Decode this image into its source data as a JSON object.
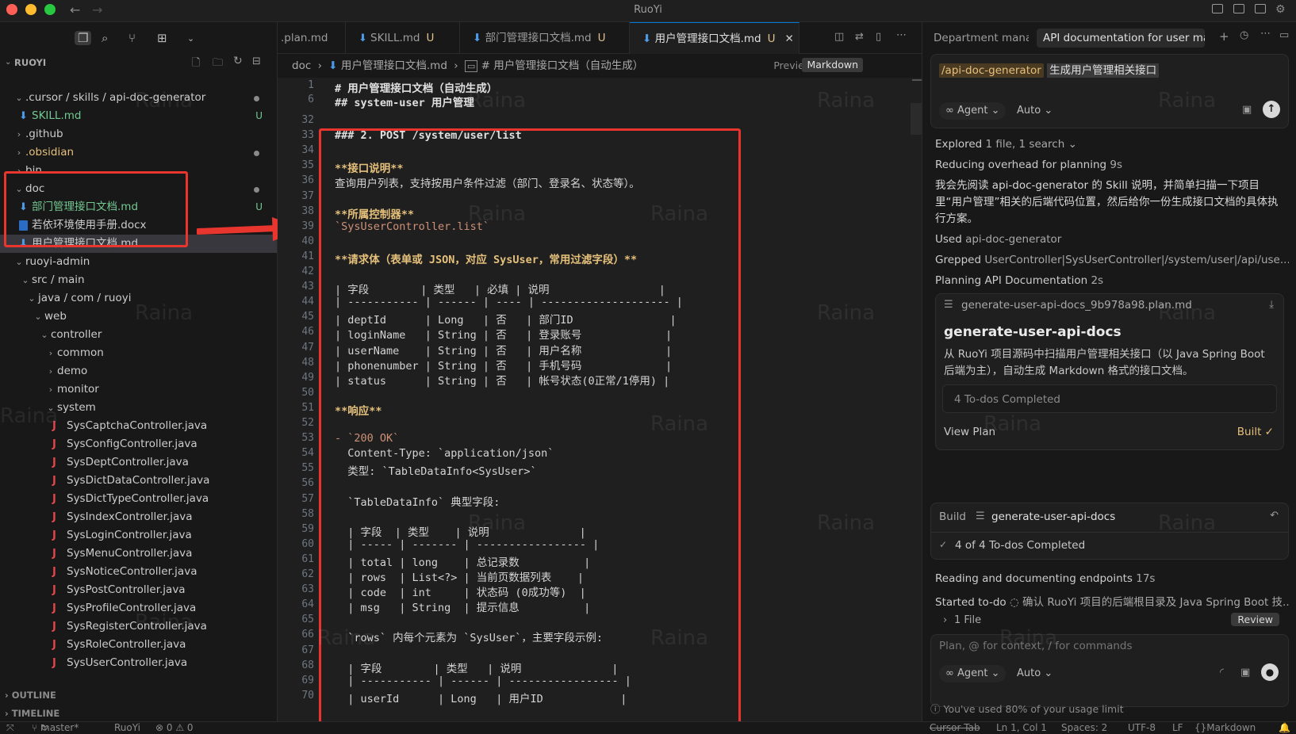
{
  "window": {
    "title": "RuoYi"
  },
  "sidebar": {
    "root_label": "RUOYI",
    "tree": [
      {
        "label": ".cursor / skills / api-doc-generator",
        "dot": true
      },
      {
        "label": "SKILL.md",
        "badge": "U"
      },
      {
        "label": ".github"
      },
      {
        "label": ".obsidian",
        "dot": true
      },
      {
        "label": "bin"
      },
      {
        "label": "doc",
        "dot": true
      },
      {
        "label": "部门管理接口文档.md",
        "badge": "U"
      },
      {
        "label": "若依环境使用手册.docx"
      },
      {
        "label": "用户管理接口文档.md"
      },
      {
        "label": "ruoyi-admin"
      },
      {
        "label": "src / main"
      },
      {
        "label": "java / com / ruoyi"
      },
      {
        "label": "web"
      },
      {
        "label": "controller"
      },
      {
        "label": "common"
      },
      {
        "label": "demo"
      },
      {
        "label": "monitor"
      },
      {
        "label": "system"
      },
      {
        "label": "SysCaptchaController.java"
      },
      {
        "label": "SysConfigController.java"
      },
      {
        "label": "SysDeptController.java"
      },
      {
        "label": "SysDictDataController.java"
      },
      {
        "label": "SysDictTypeController.java"
      },
      {
        "label": "SysIndexController.java"
      },
      {
        "label": "SysLoginController.java"
      },
      {
        "label": "SysMenuController.java"
      },
      {
        "label": "SysNoticeController.java"
      },
      {
        "label": "SysPostController.java"
      },
      {
        "label": "SysProfileController.java"
      },
      {
        "label": "SysRegisterController.java"
      },
      {
        "label": "SysRoleController.java"
      },
      {
        "label": "SysUserController.java"
      }
    ],
    "outline_label": "OUTLINE",
    "timeline_label": "TIMELINE"
  },
  "tabs": [
    {
      "label": ".plan.md"
    },
    {
      "label": "SKILL.md",
      "status": "U"
    },
    {
      "label": "部门管理接口文档.md",
      "status": "U"
    },
    {
      "label": "用户管理接口文档.md",
      "status": "U",
      "close": "✕"
    }
  ],
  "breadcrumb": {
    "parts": [
      "doc",
      "用户管理接口文档.md",
      "# 用户管理接口文档（自动生成）"
    ],
    "sep": "›",
    "preview": "Preview",
    "markdown": "Markdown"
  },
  "editor": {
    "lines": [
      {
        "n": "1",
        "text": "# 用户管理接口文档（自动生成）",
        "kind": "head"
      },
      {
        "n": "6",
        "text": "## system-user 用户管理",
        "kind": "head"
      },
      {
        "n": "32",
        "text": "",
        "kind": "plain"
      },
      {
        "n": "33",
        "text": "### 2. POST /system/user/list",
        "kind": "head"
      },
      {
        "n": "34",
        "text": "",
        "kind": "plain"
      },
      {
        "n": "35",
        "text": "**接口说明**",
        "kind": "bold"
      },
      {
        "n": "36",
        "text": "查询用户列表，支持按用户条件过滤（部门、登录名、状态等）。",
        "kind": "plain"
      },
      {
        "n": "37",
        "text": "",
        "kind": "plain"
      },
      {
        "n": "38",
        "text": "**所属控制器**",
        "kind": "bold"
      },
      {
        "n": "39",
        "text": "`SysUserController.list`",
        "kind": "inline"
      },
      {
        "n": "40",
        "text": "",
        "kind": "plain"
      },
      {
        "n": "41",
        "text": "**请求体（表单或 JSON，对应 SysUser，常用过滤字段）**",
        "kind": "bold"
      },
      {
        "n": "42",
        "text": "",
        "kind": "plain"
      },
      {
        "n": "43",
        "text": "| 字段        | 类型   | 必填 | 说明                 |",
        "kind": "plain"
      },
      {
        "n": "44",
        "text": "| ----------- | ------ | ---- | -------------------- |",
        "kind": "plain"
      },
      {
        "n": "45",
        "text": "| deptId      | Long   | 否   | 部门ID               |",
        "kind": "plain"
      },
      {
        "n": "46",
        "text": "| loginName   | String | 否   | 登录账号             |",
        "kind": "plain"
      },
      {
        "n": "47",
        "text": "| userName    | String | 否   | 用户名称             |",
        "kind": "plain"
      },
      {
        "n": "48",
        "text": "| phonenumber | String | 否   | 手机号码             |",
        "kind": "plain"
      },
      {
        "n": "49",
        "text": "| status      | String | 否   | 帐号状态(0正常/1停用) |",
        "kind": "plain"
      },
      {
        "n": "50",
        "text": "",
        "kind": "plain"
      },
      {
        "n": "51",
        "text": "**响应**",
        "kind": "bold"
      },
      {
        "n": "52",
        "text": "",
        "kind": "plain"
      },
      {
        "n": "53",
        "text": "- `200 OK`",
        "kind": "inline"
      },
      {
        "n": "54",
        "text": "  Content-Type: `application/json`",
        "kind": "plain"
      },
      {
        "n": "55",
        "text": "  类型: `TableDataInfo<SysUser>`",
        "kind": "plain"
      },
      {
        "n": "56",
        "text": "",
        "kind": "plain"
      },
      {
        "n": "57",
        "text": "  `TableDataInfo` 典型字段:",
        "kind": "plain"
      },
      {
        "n": "58",
        "text": "",
        "kind": "plain"
      },
      {
        "n": "59",
        "text": "  | 字段  | 类型    | 说明              |",
        "kind": "plain"
      },
      {
        "n": "60",
        "text": "  | ----- | ------- | ----------------- |",
        "kind": "plain"
      },
      {
        "n": "61",
        "text": "  | total | long    | 总记录数          |",
        "kind": "plain"
      },
      {
        "n": "62",
        "text": "  | rows  | List<?> | 当前页数据列表    |",
        "kind": "plain"
      },
      {
        "n": "63",
        "text": "  | code  | int     | 状态码 (0成功等)  |",
        "kind": "plain"
      },
      {
        "n": "64",
        "text": "  | msg   | String  | 提示信息          |",
        "kind": "plain"
      },
      {
        "n": "65",
        "text": "",
        "kind": "plain"
      },
      {
        "n": "66",
        "text": "  `rows` 内每个元素为 `SysUser`，主要字段示例:",
        "kind": "plain"
      },
      {
        "n": "67",
        "text": "",
        "kind": "plain"
      },
      {
        "n": "68",
        "text": "  | 字段        | 类型   | 说明              |",
        "kind": "plain"
      },
      {
        "n": "69",
        "text": "  | ----------- | ------ | ----------------- |",
        "kind": "plain"
      },
      {
        "n": "70",
        "text": "  | userId      | Long   | 用户ID            |",
        "kind": "plain"
      }
    ]
  },
  "chat": {
    "tabs": [
      "Department mana",
      "API documentation for user man"
    ],
    "prompt": {
      "command": "/api-doc-generator",
      "text": "生成用户管理相关接口"
    },
    "agent_label": "Agent",
    "auto_label": "Auto",
    "explored": {
      "prefix": "Explored",
      "detail": "1 file, 1 search"
    },
    "reducing": {
      "prefix": "Reducing overhead for planning",
      "detail": "9s"
    },
    "message": "我会先阅读 api-doc-generator 的 Skill 说明，并简单扫描一下项目里“用户管理”相关的后端代码位置，然后给你一份生成接口文档的具体执行方案。",
    "used": {
      "prefix": "Used",
      "detail": "api-doc-generator"
    },
    "grepped": {
      "prefix": "Grepped",
      "detail": "UserController|SysUserController|/system/user|/api/use..."
    },
    "planning": {
      "prefix": "Planning API Documentation",
      "detail": "2s"
    },
    "plan_card": {
      "file": "generate-user-api-docs_9b978a98.plan.md",
      "title": "generate-user-api-docs",
      "desc": "从 RuoYi 项目源码中扫描用户管理相关接口（以 Java Spring Boot 后端为主），自动生成 Markdown 格式的接口文档。",
      "todos": "4 To-dos Completed",
      "view_plan": "View Plan",
      "built": "Built ✓"
    },
    "build_card": {
      "prefix": "Build",
      "name": "generate-user-api-docs",
      "todos": "4 of 4 To-dos Completed"
    },
    "reading": {
      "prefix": "Reading and documenting endpoints",
      "detail": "17s"
    },
    "started": {
      "prefix": "Started to-do",
      "detail": "确认 RuoYi 项目的后端根目录及 Java Spring Boot 技..."
    },
    "files": {
      "label": "1 File",
      "review": "Review"
    },
    "input_placeholder": "Plan, @ for context, / for commands",
    "usage": "You've used 80% of your usage limit"
  },
  "statusbar": {
    "branch": "master*",
    "project": "RuoYi",
    "problems": "⊗ 0 ⚠ 0",
    "cursor_tab": "Cursor Tab",
    "position": "Ln 1, Col 1",
    "spaces": "Spaces: 2",
    "encoding": "UTF-8",
    "eol": "LF",
    "language": "Markdown"
  },
  "watermark": "Raina",
  "colors": {
    "annotation": "#e8362f",
    "accent": "#0078d4"
  }
}
